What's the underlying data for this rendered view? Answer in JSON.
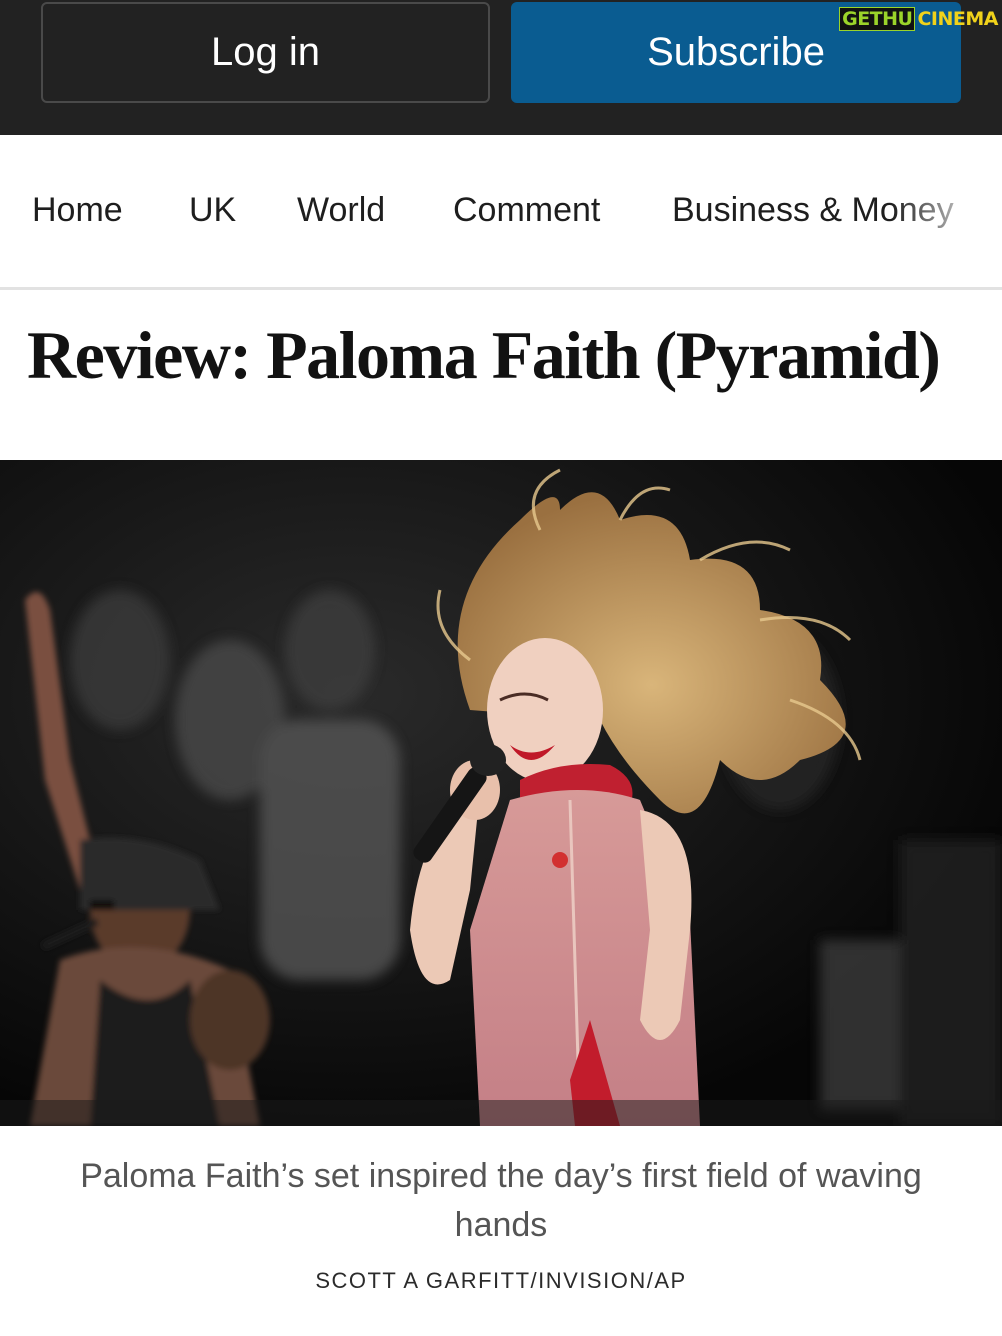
{
  "header": {
    "login_label": "Log in",
    "subscribe_label": "Subscribe",
    "watermark": {
      "part1": "GETHU",
      "part2": "CINEMA"
    }
  },
  "nav": {
    "items": [
      "Home",
      "UK",
      "World",
      "Comment",
      "Business & Money"
    ]
  },
  "article": {
    "title": "Review: Paloma Faith (Pyramid)",
    "caption": "Paloma Faith’s set inspired the day’s first field of waving hands",
    "credit": "SCOTT A GARFITT/INVISION/AP"
  },
  "colors": {
    "topbar": "#222222",
    "subscribe": "#0a5c91",
    "caption_text": "#555555"
  }
}
